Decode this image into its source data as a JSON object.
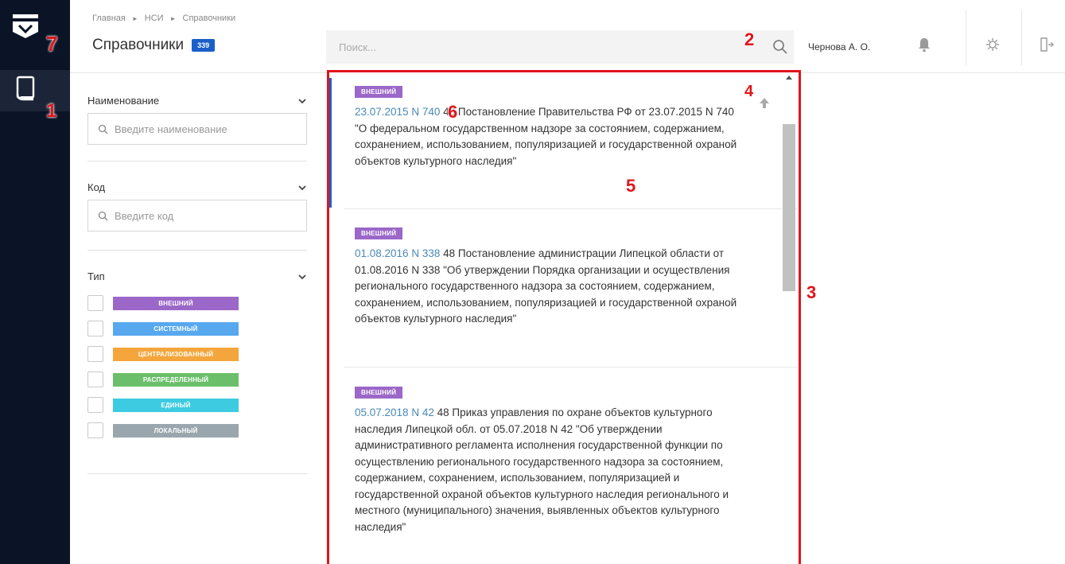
{
  "header": {
    "breadcrumb": [
      "Главная",
      "НСИ",
      "Справочники"
    ],
    "title": "Справочники",
    "count": "339",
    "search_placeholder": "Поиск...",
    "user_name": "Чернова А. О."
  },
  "filters": {
    "name": {
      "label": "Наименование",
      "placeholder": "Введите наименование"
    },
    "code": {
      "label": "Код",
      "placeholder": "Введите код"
    },
    "type": {
      "label": "Тип",
      "options": [
        {
          "label": "ВНЕШНИЙ",
          "color": "#9b67c8"
        },
        {
          "label": "СИСТЕМНЫЙ",
          "color": "#58a8ef"
        },
        {
          "label": "ЦЕНТРАЛИЗОВАННЫЙ",
          "color": "#f4a63c"
        },
        {
          "label": "РАСПРЕДЕЛЕННЫЙ",
          "color": "#6bbf6a"
        },
        {
          "label": "ЕДИНЫЙ",
          "color": "#3ccbe0"
        },
        {
          "label": "ЛОКАЛЬНЫЙ",
          "color": "#9aa6ae"
        }
      ]
    }
  },
  "list": {
    "items": [
      {
        "tag": "ВНЕШНИЙ",
        "date": "23.07.2015 N 740",
        "text": "48 Постановление Правительства РФ от 23.07.2015 N 740 \"О федеральном государственном надзоре за состоянием, содержанием, сохранением, использованием, популяризацией и государственной охраной объектов культурного наследия\""
      },
      {
        "tag": "ВНЕШНИЙ",
        "date": "01.08.2016 N 338",
        "text": "48 Постановление администрации Липецкой области от 01.08.2016 N 338 \"Об утверждении Порядка организации и осуществления регионального государственного надзора за состоянием, содержанием, сохранением, использованием, популяризацией и государственной охраной объектов культурного наследия\""
      },
      {
        "tag": "ВНЕШНИЙ",
        "date": "05.07.2018 N 42",
        "text": "48 Приказ управления по охране объектов культурного наследия Липецкой обл. от 05.07.2018 N 42 \"Об утверждении административного регламента исполнения государственной функции по осуществлению регионального государственного надзора за состоянием, содержанием, сохранением, использованием, популяризацией и государственной охраной объектов культурного наследия регионального и местного (муниципального) значения, выявленных объектов культурного наследия\""
      }
    ]
  },
  "annotations": [
    "1",
    "2",
    "3",
    "4",
    "5",
    "6",
    "7"
  ],
  "icons": [
    "logo-icon",
    "book-icon",
    "search-icon",
    "bell-icon",
    "gear-icon",
    "logout-icon",
    "chevron-down-icon",
    "scroll-top-icon"
  ]
}
